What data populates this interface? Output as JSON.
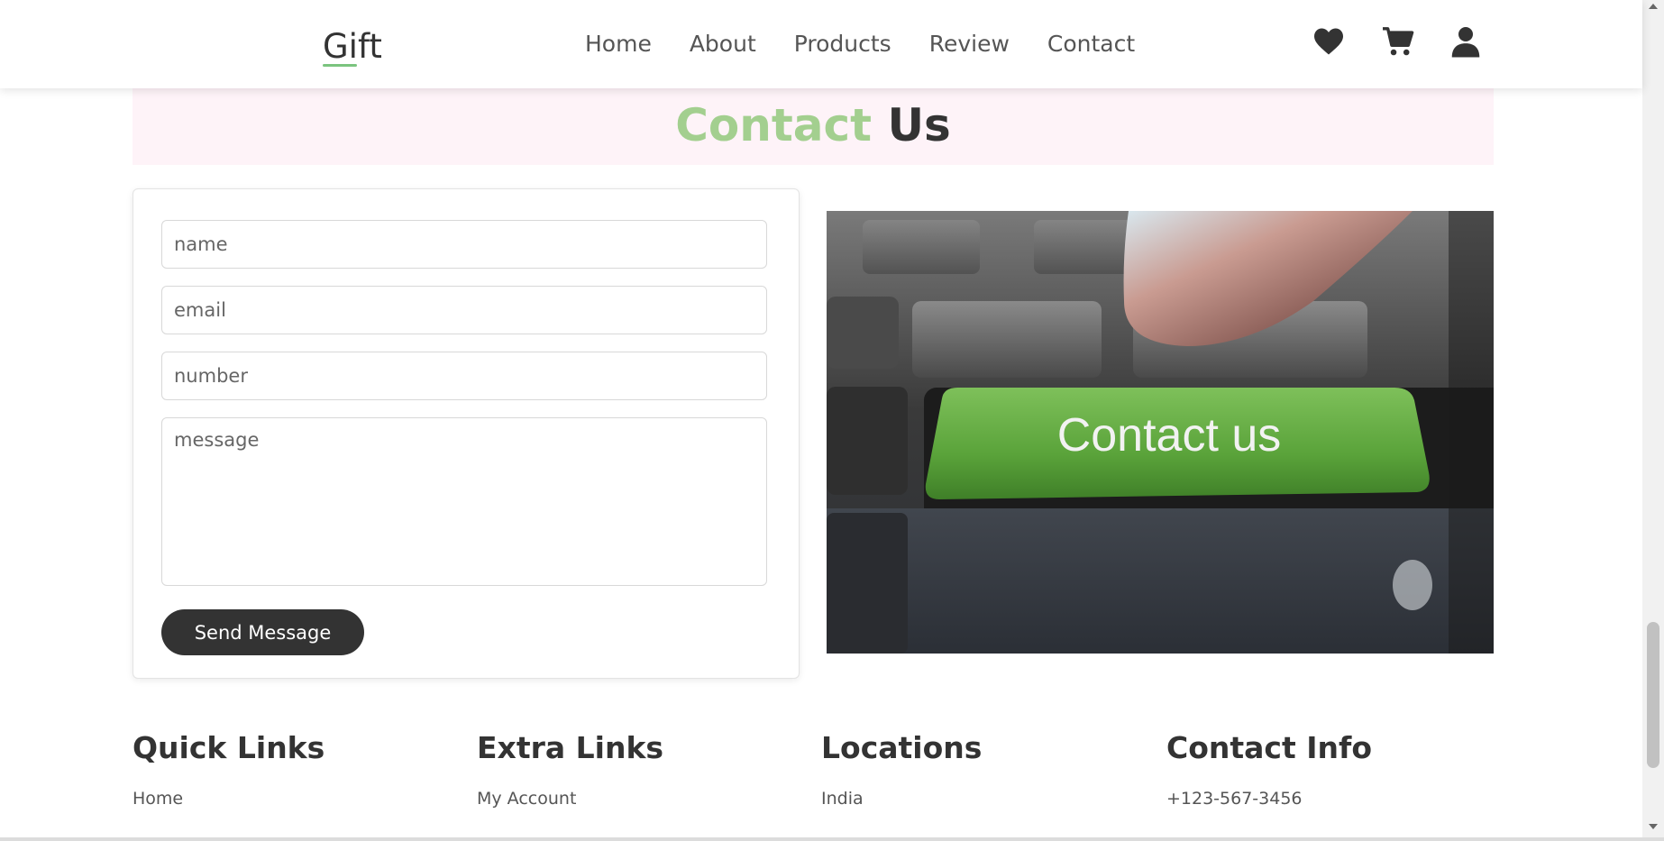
{
  "header": {
    "logo": "Gift",
    "nav": [
      "Home",
      "About",
      "Products",
      "Review",
      "Contact"
    ],
    "icons": [
      "heart-icon",
      "cart-icon",
      "user-icon"
    ]
  },
  "contact": {
    "heading_highlight": "Contact",
    "heading_rest": "Us",
    "form": {
      "name_placeholder": "name",
      "email_placeholder": "email",
      "number_placeholder": "number",
      "message_placeholder": "message",
      "submit_label": "Send Message"
    },
    "image_key_text": "Contact us"
  },
  "footer": {
    "quick_links": {
      "title": "Quick Links",
      "items": [
        "Home"
      ]
    },
    "extra_links": {
      "title": "Extra Links",
      "items": [
        "My Account"
      ]
    },
    "locations": {
      "title": "Locations",
      "items": [
        "India"
      ]
    },
    "contact_info": {
      "title": "Contact Info",
      "items": [
        "+123-567-3456"
      ]
    }
  },
  "colors": {
    "accent": "#a3cf8f",
    "dark": "#333333",
    "band": "#fef3f8",
    "button_key": "#7cb850"
  }
}
